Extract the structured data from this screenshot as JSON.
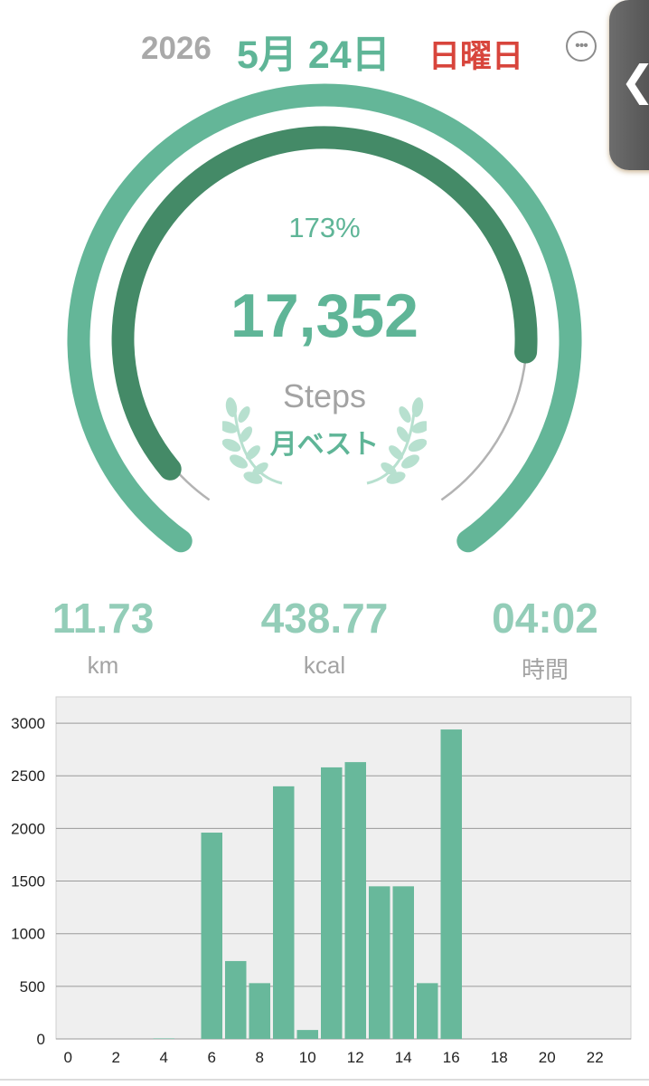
{
  "header": {
    "year": "2026",
    "date": "5月 24日",
    "weekday": "日曜日",
    "more_icon": "more-horizontal-circle-icon"
  },
  "side_tab": {
    "icon": "chevron-left-icon",
    "label": "❮"
  },
  "gauge": {
    "percent_label": "173%",
    "steps": "17,352",
    "steps_label": "Steps",
    "badge_label": "月ベスト",
    "progress_fraction": 0.86
  },
  "stats": [
    {
      "value": "11.73",
      "unit": "km"
    },
    {
      "value": "438.77",
      "unit": "kcal"
    },
    {
      "value": "04:02",
      "unit": "時間"
    }
  ],
  "colors": {
    "accent": "#5fb597",
    "arc_inner": "#448a67",
    "weekday": "#d8453c",
    "chart_bg": "#efefef",
    "bar": "#68b89b"
  },
  "chart_data": {
    "type": "bar",
    "x": [
      0,
      1,
      2,
      3,
      4,
      5,
      6,
      7,
      8,
      9,
      10,
      11,
      12,
      13,
      14,
      15,
      16,
      17,
      18,
      19,
      20,
      21,
      22,
      23
    ],
    "values": [
      0,
      0,
      0,
      0,
      5,
      0,
      1960,
      740,
      530,
      2400,
      85,
      2580,
      2630,
      1450,
      1450,
      530,
      2940,
      0,
      0,
      0,
      0,
      0,
      0,
      0
    ],
    "xticks": [
      "0",
      "2",
      "4",
      "6",
      "8",
      "10",
      "12",
      "14",
      "16",
      "18",
      "20",
      "22"
    ],
    "yticks": [
      "0",
      "500",
      "1000",
      "1500",
      "2000",
      "2500",
      "3000"
    ],
    "ylim": [
      0,
      3250
    ],
    "grid": true
  }
}
